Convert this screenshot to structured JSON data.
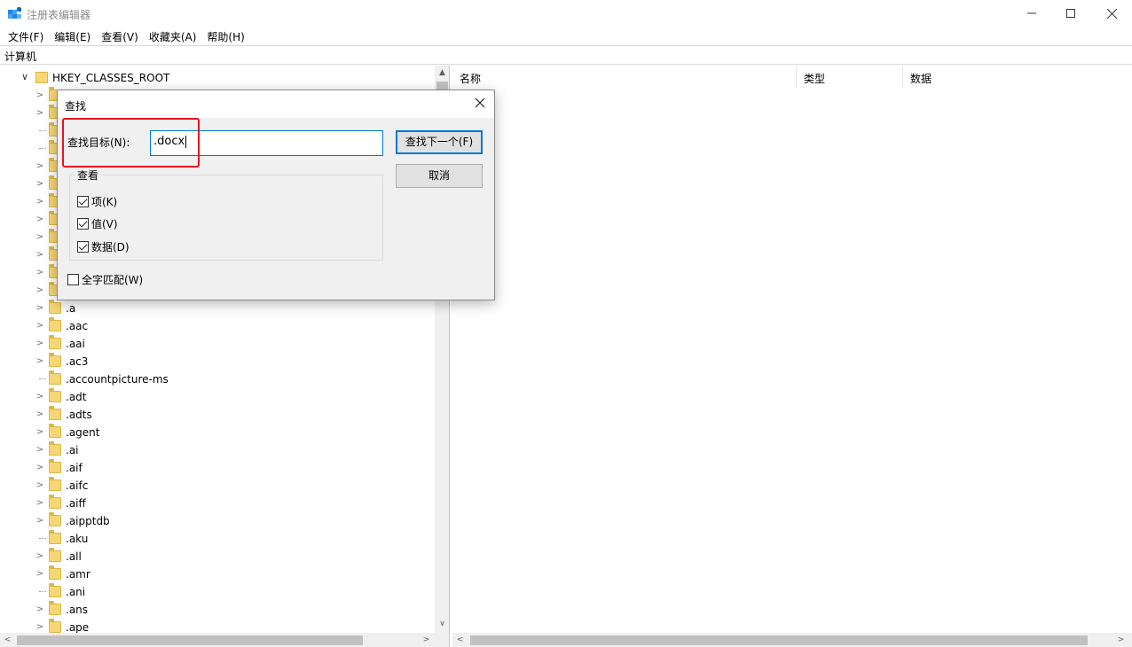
{
  "window": {
    "title": "注册表编辑器"
  },
  "menu": [
    "文件(F)",
    "编辑(E)",
    "查看(V)",
    "收藏夹(A)",
    "帮助(H)"
  ],
  "address": "计算机",
  "tree": {
    "root": "HKEY_CLASSES_ROOT",
    "items": [
      {
        "label": "",
        "expandable": true
      },
      {
        "label": "",
        "expandable": true
      },
      {
        "label": "",
        "expandable": false
      },
      {
        "label": "",
        "expandable": false
      },
      {
        "label": "",
        "expandable": true
      },
      {
        "label": "",
        "expandable": true
      },
      {
        "label": "",
        "expandable": true
      },
      {
        "label": "",
        "expandable": true
      },
      {
        "label": "",
        "expandable": true
      },
      {
        "label": "",
        "expandable": true
      },
      {
        "label": "",
        "expandable": true
      },
      {
        "label": "",
        "expandable": true
      },
      {
        "label": ".a",
        "expandable": true
      },
      {
        "label": ".aac",
        "expandable": true
      },
      {
        "label": ".aai",
        "expandable": true
      },
      {
        "label": ".ac3",
        "expandable": true
      },
      {
        "label": ".accountpicture-ms",
        "expandable": false
      },
      {
        "label": ".adt",
        "expandable": true
      },
      {
        "label": ".adts",
        "expandable": true
      },
      {
        "label": ".agent",
        "expandable": true
      },
      {
        "label": ".ai",
        "expandable": true
      },
      {
        "label": ".aif",
        "expandable": true
      },
      {
        "label": ".aifc",
        "expandable": true
      },
      {
        "label": ".aiff",
        "expandable": true
      },
      {
        "label": ".aipptdb",
        "expandable": true
      },
      {
        "label": ".aku",
        "expandable": false
      },
      {
        "label": ".all",
        "expandable": true
      },
      {
        "label": ".amr",
        "expandable": true
      },
      {
        "label": ".ani",
        "expandable": false
      },
      {
        "label": ".ans",
        "expandable": true
      },
      {
        "label": ".ape",
        "expandable": true
      }
    ]
  },
  "columns": {
    "name": "名称",
    "type": "类型",
    "data": "数据"
  },
  "dialog": {
    "title": "查找",
    "find_label": "查找目标(N):",
    "find_value": ".docx",
    "find_next": "查找下一个(F)",
    "cancel": "取消",
    "look_at_title": "查看",
    "options": [
      {
        "label": "项(K)",
        "checked": true
      },
      {
        "label": "值(V)",
        "checked": true
      },
      {
        "label": "数据(D)",
        "checked": true
      }
    ],
    "match_whole": {
      "label": "全字匹配(W)",
      "checked": false
    }
  },
  "colors": {
    "accent": "#0078d7",
    "highlight": "#e81123",
    "folder": "#f6d675"
  }
}
